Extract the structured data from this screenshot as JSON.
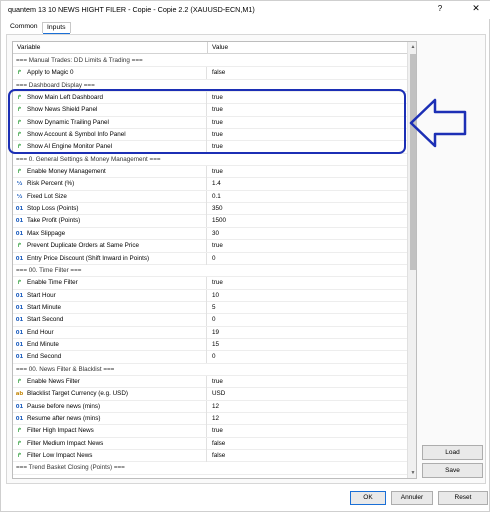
{
  "window": {
    "title": "quantem 13 10 NEWS HIGHT FILER - Copie - Copie 2.2 (XAUUSD-ECN,M1)",
    "help_glyph": "?",
    "close_glyph": "✕"
  },
  "tabs": [
    {
      "label": "Common",
      "active": false
    },
    {
      "label": "Inputs",
      "active": true
    }
  ],
  "grid": {
    "col_variable": "Variable",
    "col_value": "Value",
    "rows": [
      {
        "type": "section",
        "name": "=== Manual Trades: DD Limits & Trading ===",
        "value": ""
      },
      {
        "type": "bool",
        "icon": "bool-icon",
        "name": "Apply to Magic 0",
        "value": "false"
      },
      {
        "type": "section",
        "name": "=== Dashboard Display ===",
        "value": ""
      },
      {
        "type": "bool",
        "icon": "bool-icon",
        "name": "Show Main Left Dashboard",
        "value": "true"
      },
      {
        "type": "bool",
        "icon": "bool-icon",
        "name": "Show News Shield Panel",
        "value": "true"
      },
      {
        "type": "bool",
        "icon": "bool-icon",
        "name": "Show Dynamic Trailing Panel",
        "value": "true"
      },
      {
        "type": "bool",
        "icon": "bool-icon",
        "name": "Show Account & Symbol Info Panel",
        "value": "true"
      },
      {
        "type": "bool",
        "icon": "bool-icon",
        "name": "Show AI Engine Monitor Panel",
        "value": "true"
      },
      {
        "type": "section",
        "name": "=== 0. General Settings & Money Management ===",
        "value": ""
      },
      {
        "type": "bool",
        "icon": "bool-icon",
        "name": "Enable Money Management",
        "value": "true"
      },
      {
        "type": "dbl",
        "icon": "double-icon",
        "name": "Risk Percent (%)",
        "value": "1.4"
      },
      {
        "type": "dbl",
        "icon": "double-icon",
        "name": "Fixed Lot Size",
        "value": "0.1"
      },
      {
        "type": "int",
        "icon": "int-icon",
        "name": "Stop Loss (Points)",
        "value": "350"
      },
      {
        "type": "int",
        "icon": "int-icon",
        "name": "Take Profit (Points)",
        "value": "1500"
      },
      {
        "type": "int",
        "icon": "int-icon",
        "name": "Max Slippage",
        "value": "30"
      },
      {
        "type": "bool",
        "icon": "bool-icon",
        "name": "Prevent Duplicate Orders at Same Price",
        "value": "true"
      },
      {
        "type": "int",
        "icon": "int-icon",
        "name": "Entry Price Discount (Shift Inward in Points)",
        "value": "0"
      },
      {
        "type": "section",
        "name": "=== 00. Time Filter ===",
        "value": ""
      },
      {
        "type": "bool",
        "icon": "bool-icon",
        "name": "Enable Time Filter",
        "value": "true"
      },
      {
        "type": "int",
        "icon": "int-icon",
        "name": "Start Hour",
        "value": "10"
      },
      {
        "type": "int",
        "icon": "int-icon",
        "name": "Start Minute",
        "value": "5"
      },
      {
        "type": "int",
        "icon": "int-icon",
        "name": "Start Second",
        "value": "0"
      },
      {
        "type": "int",
        "icon": "int-icon",
        "name": "End Hour",
        "value": "19"
      },
      {
        "type": "int",
        "icon": "int-icon",
        "name": "End Minute",
        "value": "15"
      },
      {
        "type": "int",
        "icon": "int-icon",
        "name": "End Second",
        "value": "0"
      },
      {
        "type": "section",
        "name": "=== 00. News Filter & Blacklist ===",
        "value": ""
      },
      {
        "type": "bool",
        "icon": "bool-icon",
        "name": "Enable News Filter",
        "value": "true"
      },
      {
        "type": "str",
        "icon": "string-icon",
        "name": "Blacklist Target Currency (e.g. USD)",
        "value": "USD"
      },
      {
        "type": "int",
        "icon": "int-icon",
        "name": "Pause before news (mins)",
        "value": "12"
      },
      {
        "type": "int",
        "icon": "int-icon",
        "name": "Resume after news (mins)",
        "value": "12"
      },
      {
        "type": "bool",
        "icon": "bool-icon",
        "name": "Filter High Impact News",
        "value": "true"
      },
      {
        "type": "bool",
        "icon": "bool-icon",
        "name": "Filter Medium Impact News",
        "value": "false"
      },
      {
        "type": "bool",
        "icon": "bool-icon",
        "name": "Filter Low Impact News",
        "value": "false"
      },
      {
        "type": "section",
        "name": "=== Trend Basket Closing (Points) ===",
        "value": ""
      }
    ]
  },
  "icons": {
    "bool-icon": "↱",
    "int-icon": "01",
    "double-icon": "½",
    "string-icon": "ab"
  },
  "buttons": {
    "load": "Load",
    "save": "Save",
    "ok": "OK",
    "cancel": "Annuler",
    "reset": "Reset"
  },
  "annotation_color": "#1c2fb5"
}
